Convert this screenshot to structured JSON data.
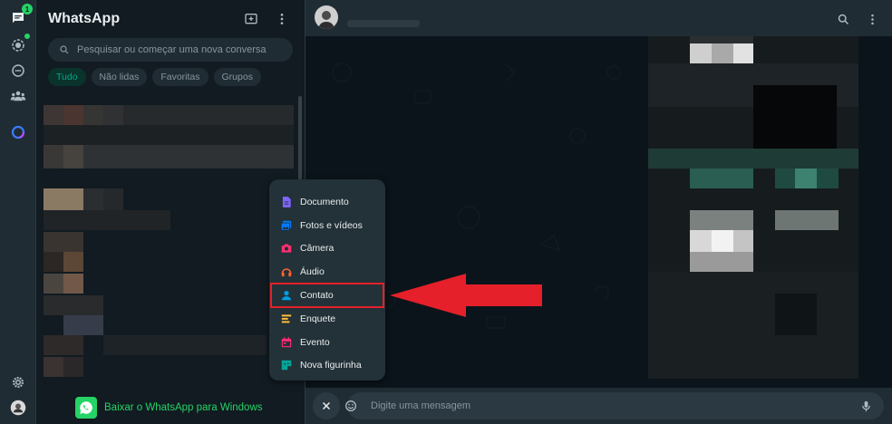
{
  "app": {
    "title": "WhatsApp",
    "chats_badge": "1"
  },
  "search": {
    "placeholder": "Pesquisar ou começar uma nova conversa"
  },
  "filters": [
    {
      "label": "Tudo",
      "active": true
    },
    {
      "label": "Não lidas",
      "active": false
    },
    {
      "label": "Favoritas",
      "active": false
    },
    {
      "label": "Grupos",
      "active": false
    }
  ],
  "download": {
    "label": "Baixar o WhatsApp para Windows"
  },
  "composer": {
    "placeholder": "Digite uma mensagem"
  },
  "attach_menu": {
    "items": [
      {
        "label": "Documento",
        "icon": "document-icon",
        "color": "#7f66ff"
      },
      {
        "label": "Fotos e vídeos",
        "icon": "photos-icon",
        "color": "#007bfc"
      },
      {
        "label": "Câmera",
        "icon": "camera-icon",
        "color": "#ff2e74"
      },
      {
        "label": "Áudio",
        "icon": "audio-icon",
        "color": "#fa6533"
      },
      {
        "label": "Contato",
        "icon": "contact-icon",
        "color": "#009de2",
        "highlighted": true
      },
      {
        "label": "Enquete",
        "icon": "poll-icon",
        "color": "#ffbc38"
      },
      {
        "label": "Evento",
        "icon": "event-icon",
        "color": "#ff2e74"
      },
      {
        "label": "Nova figurinha",
        "icon": "sticker-icon",
        "color": "#02a698"
      }
    ]
  },
  "colors": {
    "accent": "#00a884",
    "brand_green": "#25d366",
    "annotation_red": "#e5202a"
  }
}
